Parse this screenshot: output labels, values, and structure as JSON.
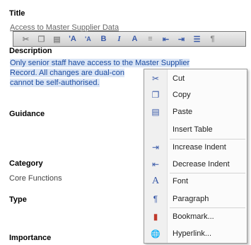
{
  "form": {
    "title_label": "Title",
    "title_value": "Access to Master Supplier Data",
    "description_label": "Description",
    "description_lines": [
      "Only senior staff have access to the Master Supplier",
      "Record. All changes are dual-con",
      "cannot be self-authorised."
    ],
    "guidance_label": "Guidance",
    "category_label": "Category",
    "category_value": "Core Functions",
    "type_label": "Type",
    "importance_label": "Importance"
  },
  "toolbar": {
    "buttons": [
      {
        "name": "cut-icon",
        "glyph": "✂"
      },
      {
        "name": "copy-icon",
        "glyph": "❐"
      },
      {
        "name": "paste-icon",
        "glyph": "▤"
      },
      {
        "name": "grow-font-icon",
        "glyph": "'A"
      },
      {
        "name": "shrink-font-icon",
        "glyph": "'A"
      },
      {
        "name": "bold-icon",
        "glyph": "B"
      },
      {
        "name": "italic-icon",
        "glyph": "I"
      },
      {
        "name": "font-color-icon",
        "glyph": "A"
      },
      {
        "name": "align-icon",
        "glyph": "≡"
      },
      {
        "name": "decrease-indent-icon",
        "glyph": "⇤"
      },
      {
        "name": "increase-indent-icon",
        "glyph": "⇥"
      },
      {
        "name": "list-icon",
        "glyph": "☰"
      },
      {
        "name": "paragraph-icon",
        "glyph": "¶"
      }
    ]
  },
  "context_menu": {
    "items": [
      {
        "label": "Cut",
        "icon": "cut-icon",
        "glyph": "✂"
      },
      {
        "label": "Copy",
        "icon": "copy-icon",
        "glyph": "❐"
      },
      {
        "label": "Paste",
        "icon": "paste-icon",
        "glyph": "▤"
      },
      {
        "label": "Insert Table",
        "icon": "",
        "glyph": ""
      },
      {
        "label": "Increase Indent",
        "icon": "increase-indent-icon",
        "glyph": "⇥"
      },
      {
        "label": "Decrease Indent",
        "icon": "decrease-indent-icon",
        "glyph": "⇤"
      },
      {
        "label": "Font",
        "icon": "font-icon",
        "glyph": "A"
      },
      {
        "label": "Paragraph",
        "icon": "paragraph-icon",
        "glyph": "¶"
      },
      {
        "label": "Bookmark...",
        "icon": "bookmark-icon",
        "glyph": "▮"
      },
      {
        "label": "Hyperlink...",
        "icon": "hyperlink-icon",
        "glyph": "🌐"
      }
    ]
  },
  "colors": {
    "selection": "#dbe6f6",
    "link_text": "#1a4aa0",
    "icon_blue": "#3a5aa8"
  }
}
